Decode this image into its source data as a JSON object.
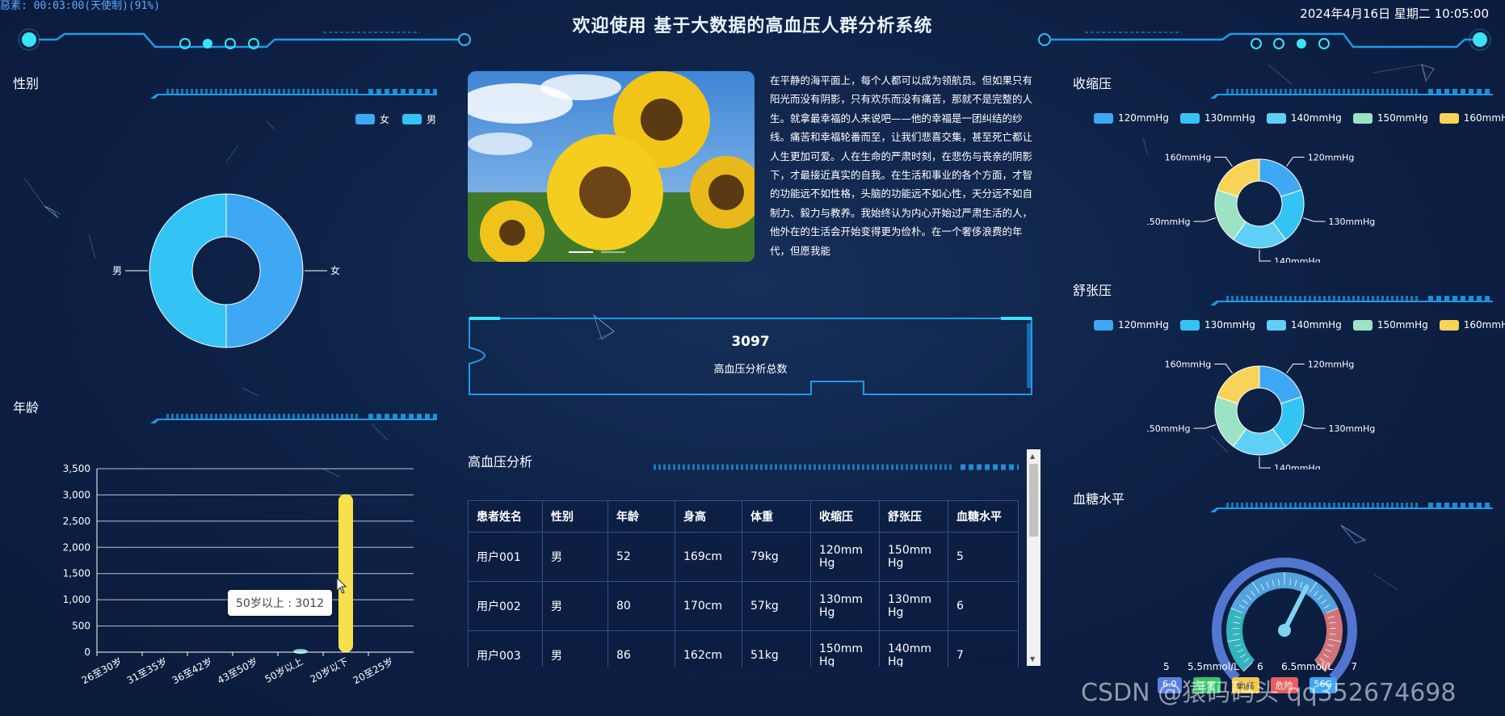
{
  "header": {
    "status": "惡素: 00:03:00(天使制)(91%)",
    "title": "欢迎使用 基于大数据的高血压人群分析系统",
    "datetime": "2024年4月16日 星期二 10:05:00"
  },
  "gender_panel": {
    "title": "性别",
    "legend": [
      {
        "label": "女",
        "color": "#3ea8f5"
      },
      {
        "label": "男",
        "color": "#33c3f5"
      }
    ],
    "slice_labels": [
      "男",
      "女"
    ]
  },
  "age_panel": {
    "title": "年龄",
    "tooltip": "50岁以上 : 3012"
  },
  "article": {
    "text": "在平静的海平面上，每个人都可以成为领航员。但如果只有阳光而没有阴影，只有欢乐而没有痛苦，那就不是完整的人生。就拿最幸福的人来说吧——他的幸福是一团纠结的纱线。痛苦和幸福轮番而至，让我们悲喜交集，甚至死亡都让人生更加可爱。人在生命的严肃时刻，在悲伤与丧亲的阴影下，才最接近真实的自我。在生活和事业的各个方面，才智的功能远不如性格，头脑的功能远不如心性，天分远不如自制力、毅力与教养。我始终认为内心开始过严肃生活的人，他外在的生活会开始变得更为俭朴。在一个奢侈浪费的年代，但愿我能"
  },
  "total": {
    "value": "3097",
    "label": "高血压分析总数"
  },
  "table_panel": {
    "title": "高血压分析",
    "columns": [
      "患者姓名",
      "性别",
      "年龄",
      "身高",
      "体重",
      "收缩压",
      "舒张压",
      "血糖水平"
    ],
    "rows": [
      [
        "用户001",
        "男",
        "52",
        "169cm",
        "79kg",
        "120mmHg",
        "150mmHg",
        "5"
      ],
      [
        "用户002",
        "男",
        "80",
        "170cm",
        "57kg",
        "130mmHg",
        "130mmHg",
        "6"
      ],
      [
        "用户003",
        "男",
        "86",
        "162cm",
        "51kg",
        "150mmHg",
        "140mmHg",
        "7"
      ]
    ]
  },
  "systolic_panel": {
    "title": "收缩压",
    "legend": [
      {
        "label": "120mmHg",
        "color": "#3ea8f5"
      },
      {
        "label": "130mmHg",
        "color": "#33c3f5"
      },
      {
        "label": "140mmHg",
        "color": "#5fd0f5"
      },
      {
        "label": "150mmHg",
        "color": "#9be3c4"
      },
      {
        "label": "160mmHg",
        "color": "#f7d358"
      }
    ]
  },
  "diastolic_panel": {
    "title": "舒张压",
    "legend": [
      {
        "label": "120mmHg",
        "color": "#3ea8f5"
      },
      {
        "label": "130mmHg",
        "color": "#33c3f5"
      },
      {
        "label": "140mmHg",
        "color": "#5fd0f5"
      },
      {
        "label": "150mmHg",
        "color": "#9be3c4"
      },
      {
        "label": "160mmHg",
        "color": "#f7d358"
      }
    ]
  },
  "glucose_panel": {
    "title": "血糖水平",
    "scale_labels": [
      "5",
      "5.5mmol/L",
      "6",
      "6.5mmol/L",
      "7"
    ],
    "chips": [
      "6.0",
      "正常",
      "偏高",
      "危险",
      "56G"
    ],
    "chip_colors": [
      "#5b7fe0",
      "#39c469",
      "#f2c94c",
      "#e85d5d",
      "#3ea8f5"
    ],
    "value": 6.2,
    "min": 5,
    "max": 7
  },
  "watermark": "CSDN @猿码码头 qq352674698",
  "chart_data": [
    {
      "type": "pie",
      "name": "性别",
      "labels": [
        "女",
        "男"
      ],
      "values": [
        50,
        50
      ],
      "colors": [
        "#3ea8f5",
        "#33c3f5"
      ]
    },
    {
      "type": "bar",
      "name": "年龄",
      "categories": [
        "26至30岁",
        "31至35岁",
        "36至42岁",
        "43至50岁",
        "50岁以上",
        "20岁以下",
        "20至25岁"
      ],
      "values": [
        0,
        0,
        0,
        0,
        60,
        3012,
        0
      ],
      "colors": [
        "#5ed3f0",
        "#5ed3f0",
        "#5ed3f0",
        "#5ed3f0",
        "#7fd6c8",
        "#f7e04b",
        "#5ed3f0"
      ],
      "ylim": [
        0,
        3500
      ],
      "yticks": [
        0,
        500,
        1000,
        1500,
        2000,
        2500,
        3000,
        3500
      ],
      "ytick_labels": [
        "0",
        "500",
        "1,000",
        "1,500",
        "2,000",
        "2,500",
        "3,000",
        "3,500"
      ]
    },
    {
      "type": "pie",
      "name": "收缩压",
      "labels": [
        "120mmHg",
        "130mmHg",
        "140mmHg",
        "150mmHg",
        "160mmHg"
      ],
      "values": [
        20,
        20,
        20,
        20,
        20
      ],
      "colors": [
        "#3ea8f5",
        "#33c3f5",
        "#5fd0f5",
        "#9be3c4",
        "#f7d358"
      ]
    },
    {
      "type": "pie",
      "name": "舒张压",
      "labels": [
        "120mmHg",
        "130mmHg",
        "140mmHg",
        "150mmHg",
        "160mmHg"
      ],
      "values": [
        20,
        20,
        20,
        20,
        20
      ],
      "colors": [
        "#3ea8f5",
        "#33c3f5",
        "#5fd0f5",
        "#9be3c4",
        "#f7d358"
      ]
    }
  ]
}
